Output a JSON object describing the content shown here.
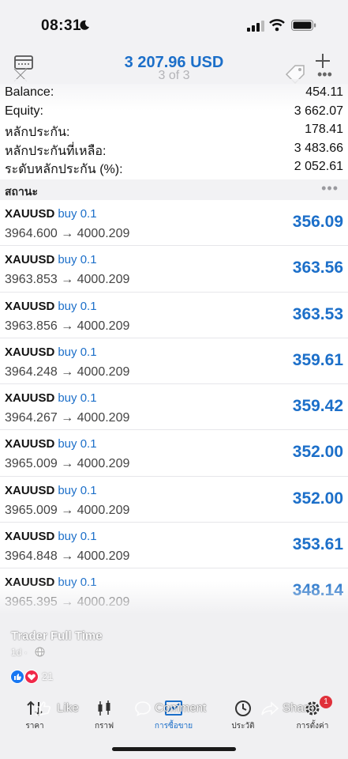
{
  "status_bar": {
    "time": "08:31"
  },
  "header": {
    "title": "3 207.96 USD",
    "subtitle": "3 of 3"
  },
  "summary": [
    {
      "label": "Balance:",
      "value": "454.11"
    },
    {
      "label": "Equity:",
      "value": "3 662.07"
    },
    {
      "label": "หลักประกัน:",
      "value": "178.41"
    },
    {
      "label": "หลักประกันที่เหลือ:",
      "value": "3 483.66"
    },
    {
      "label": "ระดับหลักประกัน (%):",
      "value": "2 052.61"
    }
  ],
  "section": {
    "title": "สถานะ",
    "more": "•••"
  },
  "positions": [
    {
      "symbol": "XAUUSD",
      "side": "buy 0.1",
      "prices": "3964.600 → 4000.209",
      "profit": "356.09"
    },
    {
      "symbol": "XAUUSD",
      "side": "buy 0.1",
      "prices": "3963.853 → 4000.209",
      "profit": "363.56"
    },
    {
      "symbol": "XAUUSD",
      "side": "buy 0.1",
      "prices": "3963.856 → 4000.209",
      "profit": "363.53"
    },
    {
      "symbol": "XAUUSD",
      "side": "buy 0.1",
      "prices": "3964.248 → 4000.209",
      "profit": "359.61"
    },
    {
      "symbol": "XAUUSD",
      "side": "buy 0.1",
      "prices": "3964.267 → 4000.209",
      "profit": "359.42"
    },
    {
      "symbol": "XAUUSD",
      "side": "buy 0.1",
      "prices": "3965.009 → 4000.209",
      "profit": "352.00"
    },
    {
      "symbol": "XAUUSD",
      "side": "buy 0.1",
      "prices": "3965.009 → 4000.209",
      "profit": "352.00"
    },
    {
      "symbol": "XAUUSD",
      "side": "buy 0.1",
      "prices": "3964.848 → 4000.209",
      "profit": "353.61"
    },
    {
      "symbol": "XAUUSD",
      "side": "buy 0.1",
      "prices": "3965.395 → 4000.209",
      "profit": "348.14"
    }
  ],
  "facebook": {
    "page_name": "Trader Full Time",
    "time": "1d ·",
    "reactions_count": "21",
    "actions": {
      "like": "Like",
      "comment": "Comment",
      "share": "Share"
    }
  },
  "tabs": [
    {
      "label": "ราคา",
      "icon": "arrows-updown-icon"
    },
    {
      "label": "กราฟ",
      "icon": "candlestick-icon"
    },
    {
      "label": "การซื้อขาย",
      "icon": "trade-chart-icon",
      "active": true
    },
    {
      "label": "ประวัติ",
      "icon": "history-icon"
    },
    {
      "label": "การตั้งค่า",
      "icon": "gear-icon"
    }
  ],
  "settings_badge": "1",
  "colors": {
    "accent": "#1c6fc9",
    "badge": "#e0303a",
    "bar_bg": "#f2f2f4"
  }
}
